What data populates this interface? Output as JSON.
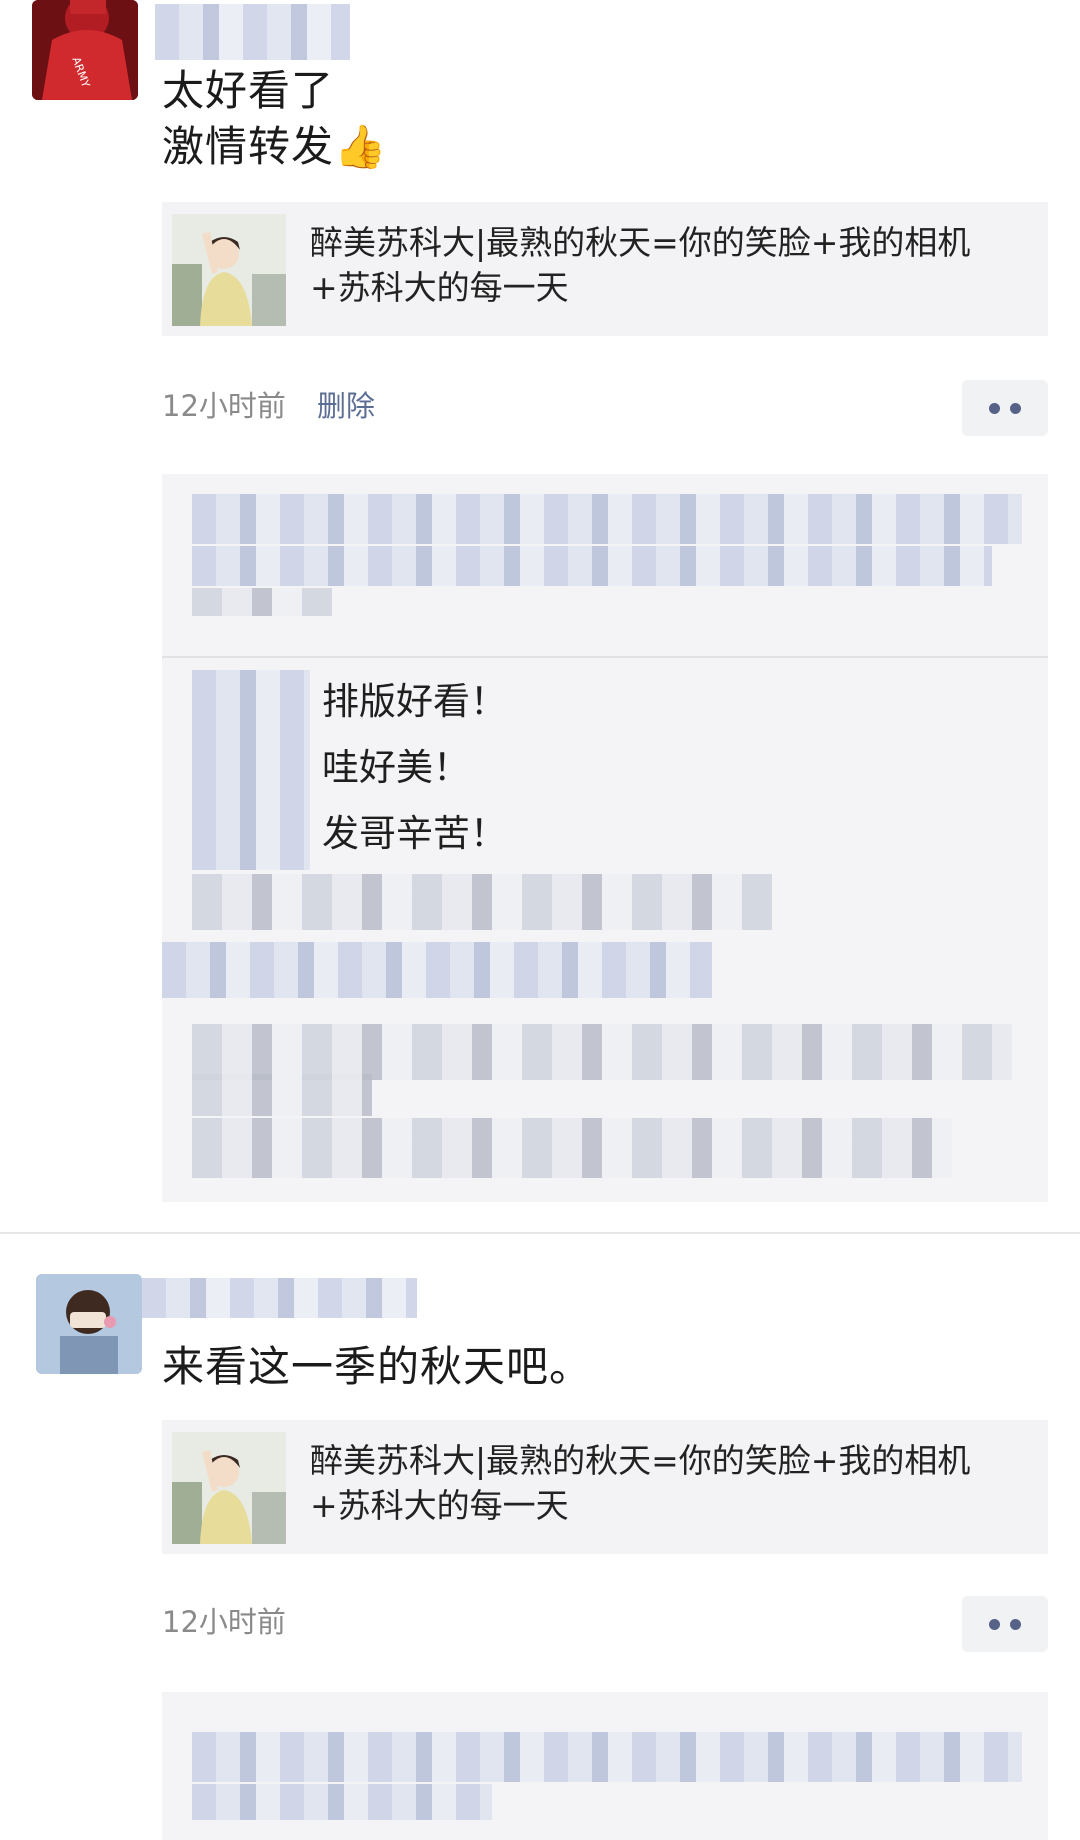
{
  "posts": [
    {
      "text_lines": [
        "太好看了",
        "激情转发👍"
      ],
      "link": {
        "title": "醉美苏科大|最熟的秋天=你的笑脸+我的相机+苏科大的每一天"
      },
      "time": "12小时前",
      "delete_label": "删除",
      "comments": [
        "排版好看！",
        "哇好美！",
        "发哥辛苦！"
      ]
    },
    {
      "text_lines": [
        "来看这一季的秋天吧。"
      ],
      "link": {
        "title": "醉美苏科大|最熟的秋天=你的笑脸+我的相机+苏科大的每一天"
      },
      "time": "12小时前"
    }
  ],
  "icons": {
    "more": "more-dots-icon",
    "thumbs_up": "thumbs-up-emoji"
  }
}
